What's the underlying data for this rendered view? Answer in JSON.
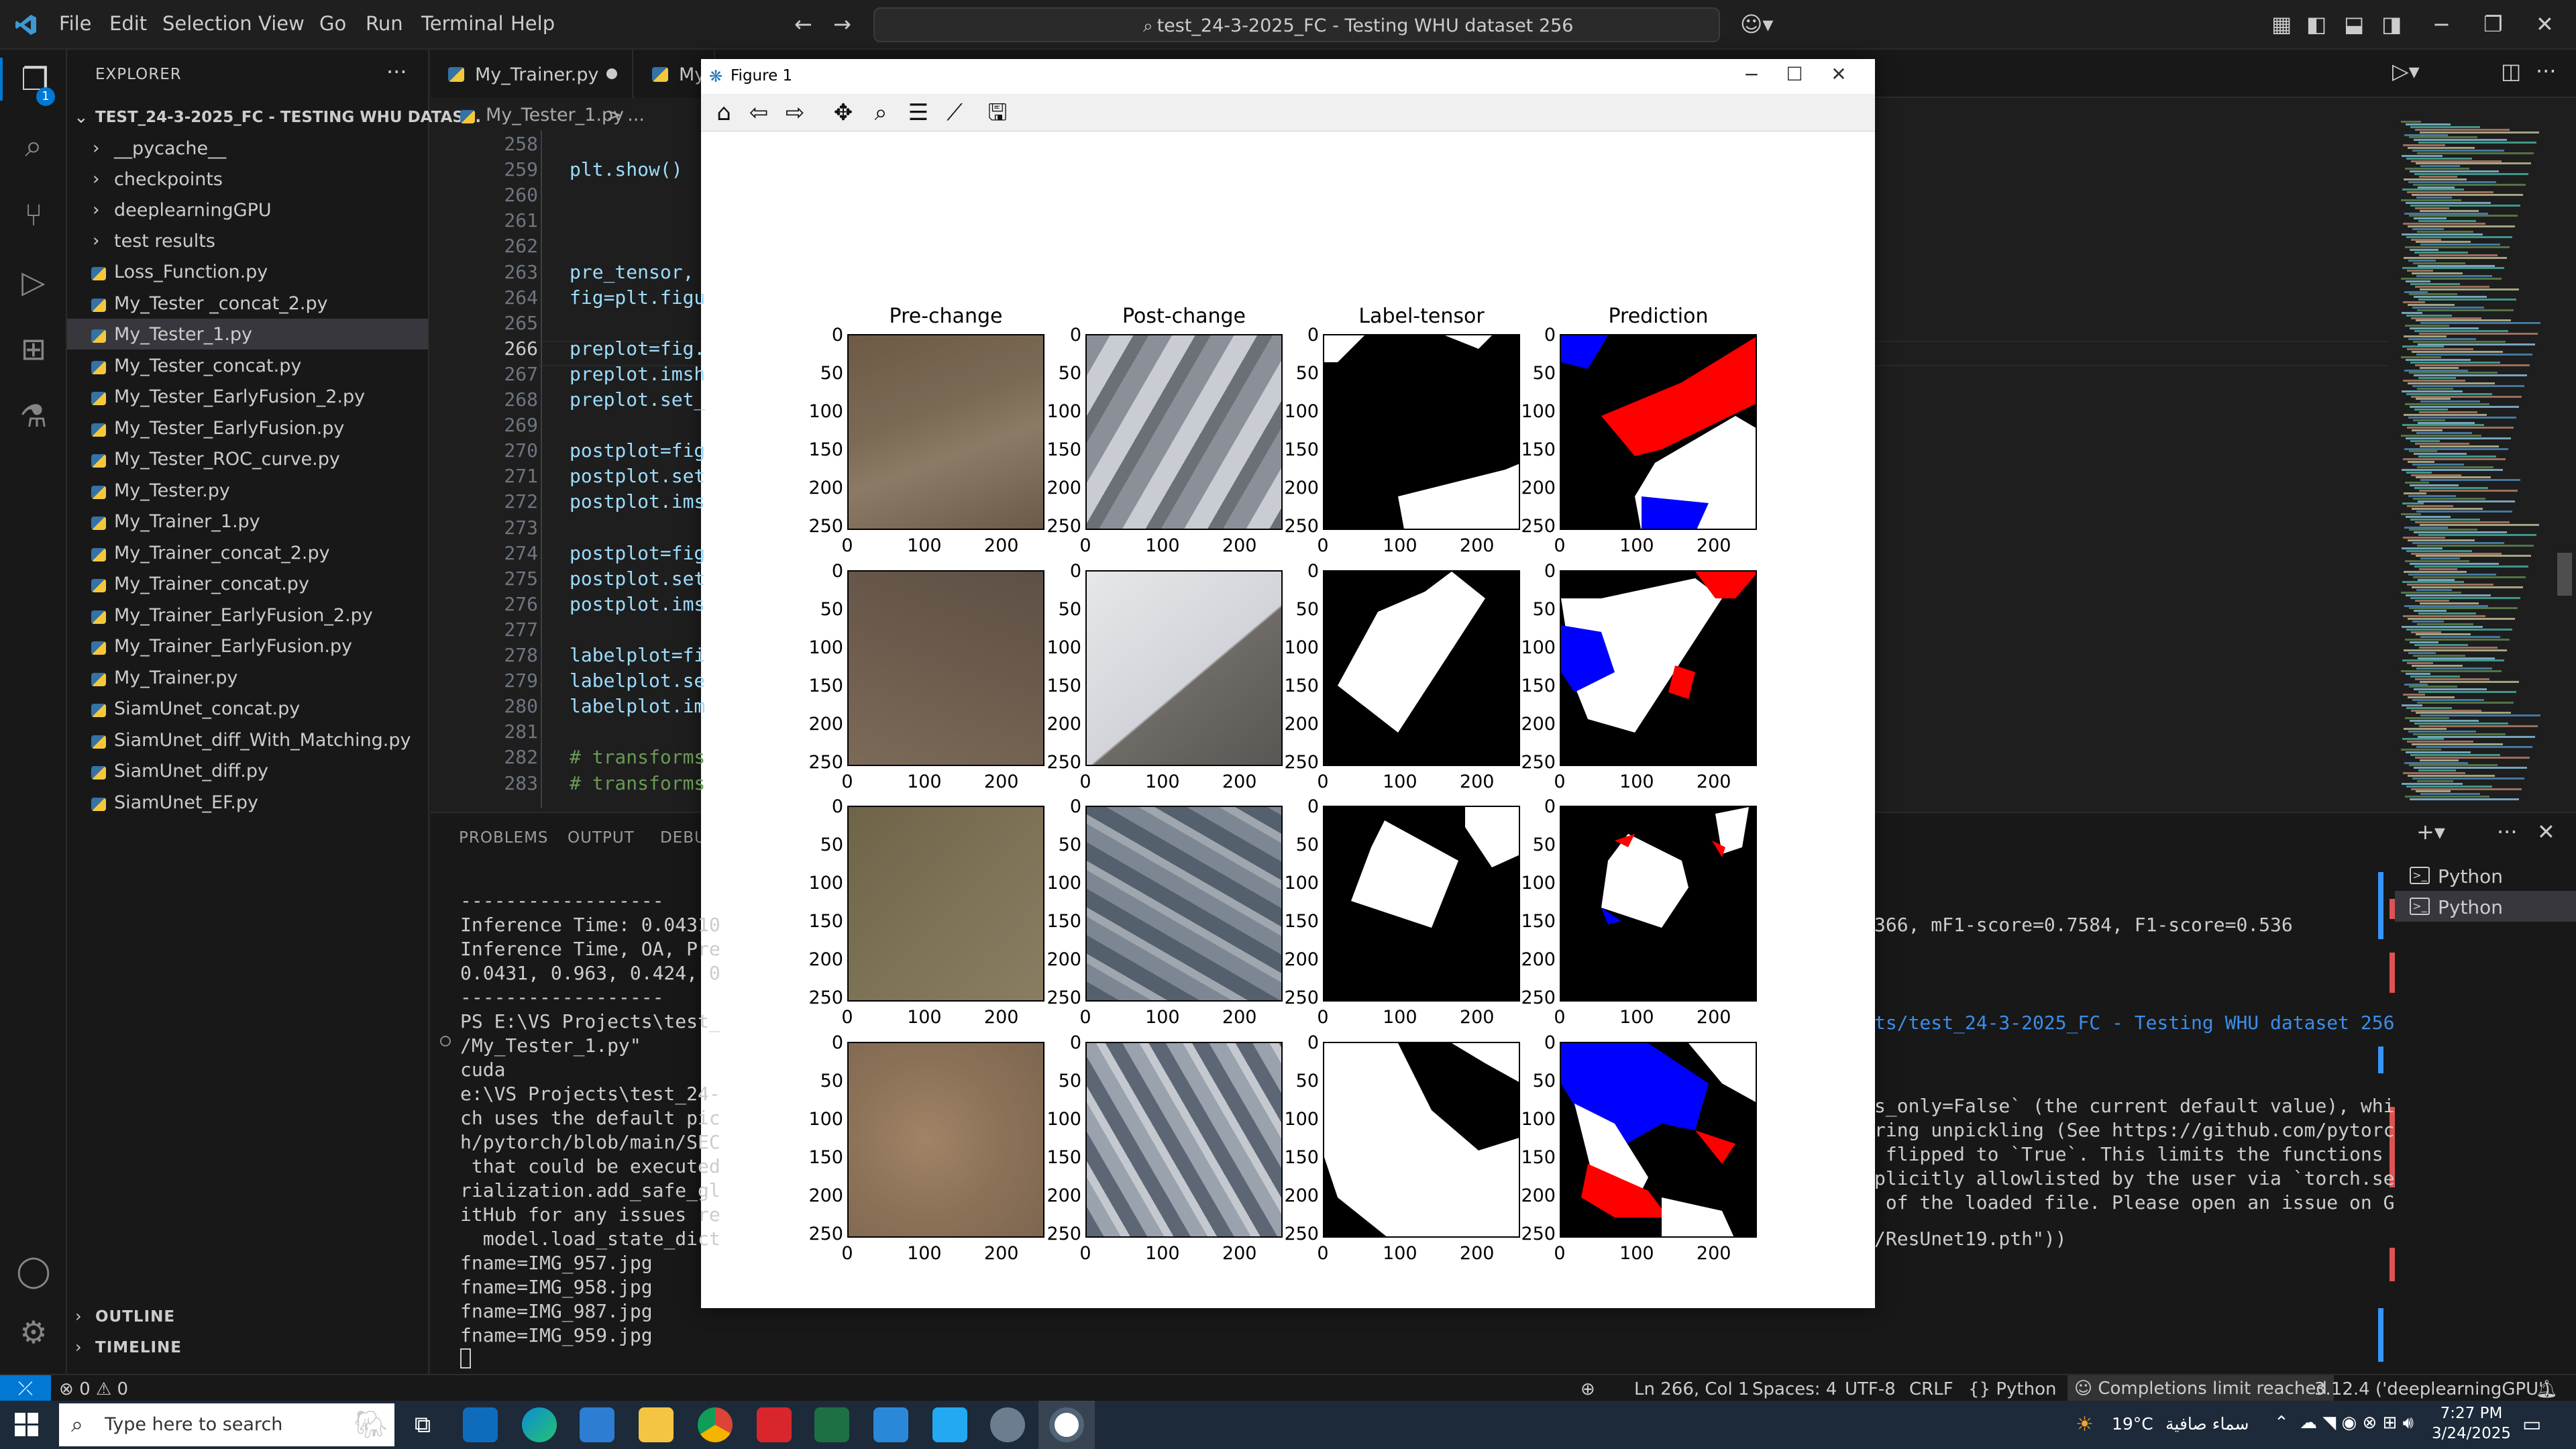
{
  "titlebar": {
    "menu": [
      "File",
      "Edit",
      "Selection",
      "View",
      "Go",
      "Run",
      "Terminal",
      "Help"
    ],
    "command_center": "test_24-3-2025_FC - Testing WHU dataset 256"
  },
  "sidebar": {
    "title": "EXPLORER",
    "folder": "TEST_24-3-2025_FC - TESTING WHU DATAS...",
    "folders": [
      "__pycache__",
      "checkpoints",
      "deeplearningGPU",
      "test results"
    ],
    "files": [
      "Loss_Function.py",
      "My_Tester _concat_2.py",
      "My_Tester_1.py",
      "My_Tester_concat.py",
      "My_Tester_EarlyFusion_2.py",
      "My_Tester_EarlyFusion.py",
      "My_Tester_ROC_curve.py",
      "My_Tester.py",
      "My_Trainer_1.py",
      "My_Trainer_concat_2.py",
      "My_Trainer_concat.py",
      "My_Trainer_EarlyFusion_2.py",
      "My_Trainer_EarlyFusion.py",
      "My_Trainer.py",
      "SiamUnet_concat.py",
      "SiamUnet_diff_With_Matching.py",
      "SiamUnet_diff.py",
      "SiamUnet_EF.py"
    ],
    "selected_file": "My_Tester_1.py",
    "outline": "OUTLINE",
    "timeline": "TIMELINE"
  },
  "editor": {
    "tabs": [
      "My_Trainer.py",
      "My"
    ],
    "breadcrumb_file": "My_Tester_1.py",
    "breadcrumb_rest": "> ...",
    "lines": [
      {
        "n": "258",
        "text": ""
      },
      {
        "n": "259",
        "text": "plt.show()"
      },
      {
        "n": "260",
        "text": ""
      },
      {
        "n": "261",
        "text": ""
      },
      {
        "n": "262",
        "text": ""
      },
      {
        "n": "263",
        "text": "pre_tensor,"
      },
      {
        "n": "264",
        "text": "fig=plt.figu"
      },
      {
        "n": "265",
        "text": ""
      },
      {
        "n": "266",
        "text": "preplot=fig."
      },
      {
        "n": "267",
        "text": "preplot.imsh"
      },
      {
        "n": "268",
        "text": "preplot.set_"
      },
      {
        "n": "269",
        "text": ""
      },
      {
        "n": "270",
        "text": "postplot=fig"
      },
      {
        "n": "271",
        "text": "postplot.set"
      },
      {
        "n": "272",
        "text": "postplot.ims"
      },
      {
        "n": "273",
        "text": ""
      },
      {
        "n": "274",
        "text": "postplot=fig"
      },
      {
        "n": "275",
        "text": "postplot.set"
      },
      {
        "n": "276",
        "text": "postplot.ims"
      },
      {
        "n": "277",
        "text": ""
      },
      {
        "n": "278",
        "text": "labelplot=fi"
      },
      {
        "n": "279",
        "text": "labelplot.se"
      },
      {
        "n": "280",
        "text": "labelplot.im"
      },
      {
        "n": "281",
        "text": ""
      },
      {
        "n": "282",
        "text": "# transforms"
      },
      {
        "n": "283",
        "text": "# transforms"
      }
    ],
    "active_line": "266"
  },
  "panel": {
    "tabs": [
      "PROBLEMS",
      "OUTPUT",
      "DEBU"
    ],
    "terminal_left": [
      "------------------",
      "Inference Time: 0.04310",
      "Inference Time, OA, Pre",
      "0.0431, 0.963, 0.424, 0",
      "------------------",
      "PS E:\\VS Projects\\test_",
      "/My_Tester_1.py\"",
      "cuda",
      "e:\\VS Projects\\test_24-",
      "ch uses the default pic",
      "h/pytorch/blob/main/SEC",
      " that could be executed",
      "rialization.add_safe_gl",
      "itHub for any issues re",
      "  model.load_state_dict",
      "fname=IMG_957.jpg",
      "fname=IMG_958.jpg",
      "fname=IMG_987.jpg",
      "fname=IMG_959.jpg"
    ],
    "terminal_right": [
      "366, mF1-score=0.7584, F1-score=0.536",
      "ts/test_24-3-2025_FC - Testing WHU dataset 256",
      "s_only=False` (the current default value), whi",
      "ring unpickling (See https://github.com/pytorc",
      " flipped to `True`. This limits the functions",
      "plicitly allowlisted by the user via `torch.se",
      " of the loaded file. Please open an issue on G",
      "/ResUnet19.pth\"))"
    ],
    "terminals": [
      "Python",
      "Python"
    ]
  },
  "statusbar": {
    "problems": "0",
    "warnings": "0",
    "position": "Ln 266, Col 1",
    "spaces": "Spaces: 4",
    "encoding": "UTF-8",
    "eol": "CRLF",
    "language": "Python",
    "completions": "Completions limit reached",
    "interpreter": "3.12.4 ('deeplearningGPU')"
  },
  "taskbar": {
    "search_placeholder": "Type here to search",
    "weather": "19°C",
    "weather_text": "سماء صافية",
    "time": "7:27 PM",
    "date": "3/24/2025"
  },
  "figure": {
    "window_title": "Figure 1",
    "column_titles": [
      "Pre-change",
      "Post-change",
      "Label-tensor",
      "Prediction"
    ],
    "y_ticks": [
      "0",
      "50",
      "100",
      "150",
      "200",
      "250"
    ],
    "x_ticks": [
      "0",
      "100",
      "200"
    ],
    "rows": 4
  },
  "colors": {
    "accent": "#0078d4",
    "editor_bg": "#1e1e1e",
    "sidebar_bg": "#181818",
    "prediction_fp": "#ff0000",
    "prediction_fn": "#0000ff"
  }
}
